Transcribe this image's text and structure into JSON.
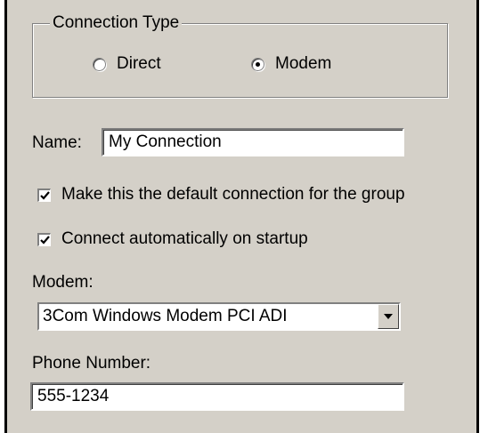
{
  "connection_type": {
    "legend": "Connection Type",
    "options": [
      {
        "label": "Direct",
        "checked": false
      },
      {
        "label": "Modem",
        "checked": true
      }
    ]
  },
  "name": {
    "label": "Name:",
    "value": "My Connection"
  },
  "checkboxes": [
    {
      "label": "Make this the default connection for the group",
      "checked": true
    },
    {
      "label": "Connect automatically on startup",
      "checked": true
    }
  ],
  "modem": {
    "label": "Modem:",
    "selected": "3Com Windows Modem PCI ADI"
  },
  "phone": {
    "label": "Phone Number:",
    "value": "555-1234"
  },
  "colors": {
    "dialog_face": "#d4d0c8",
    "field_background": "#ffffff",
    "border_shadow": "#808080"
  },
  "icons": {
    "dropdown": "chevron-down-icon",
    "check": "check-icon"
  }
}
